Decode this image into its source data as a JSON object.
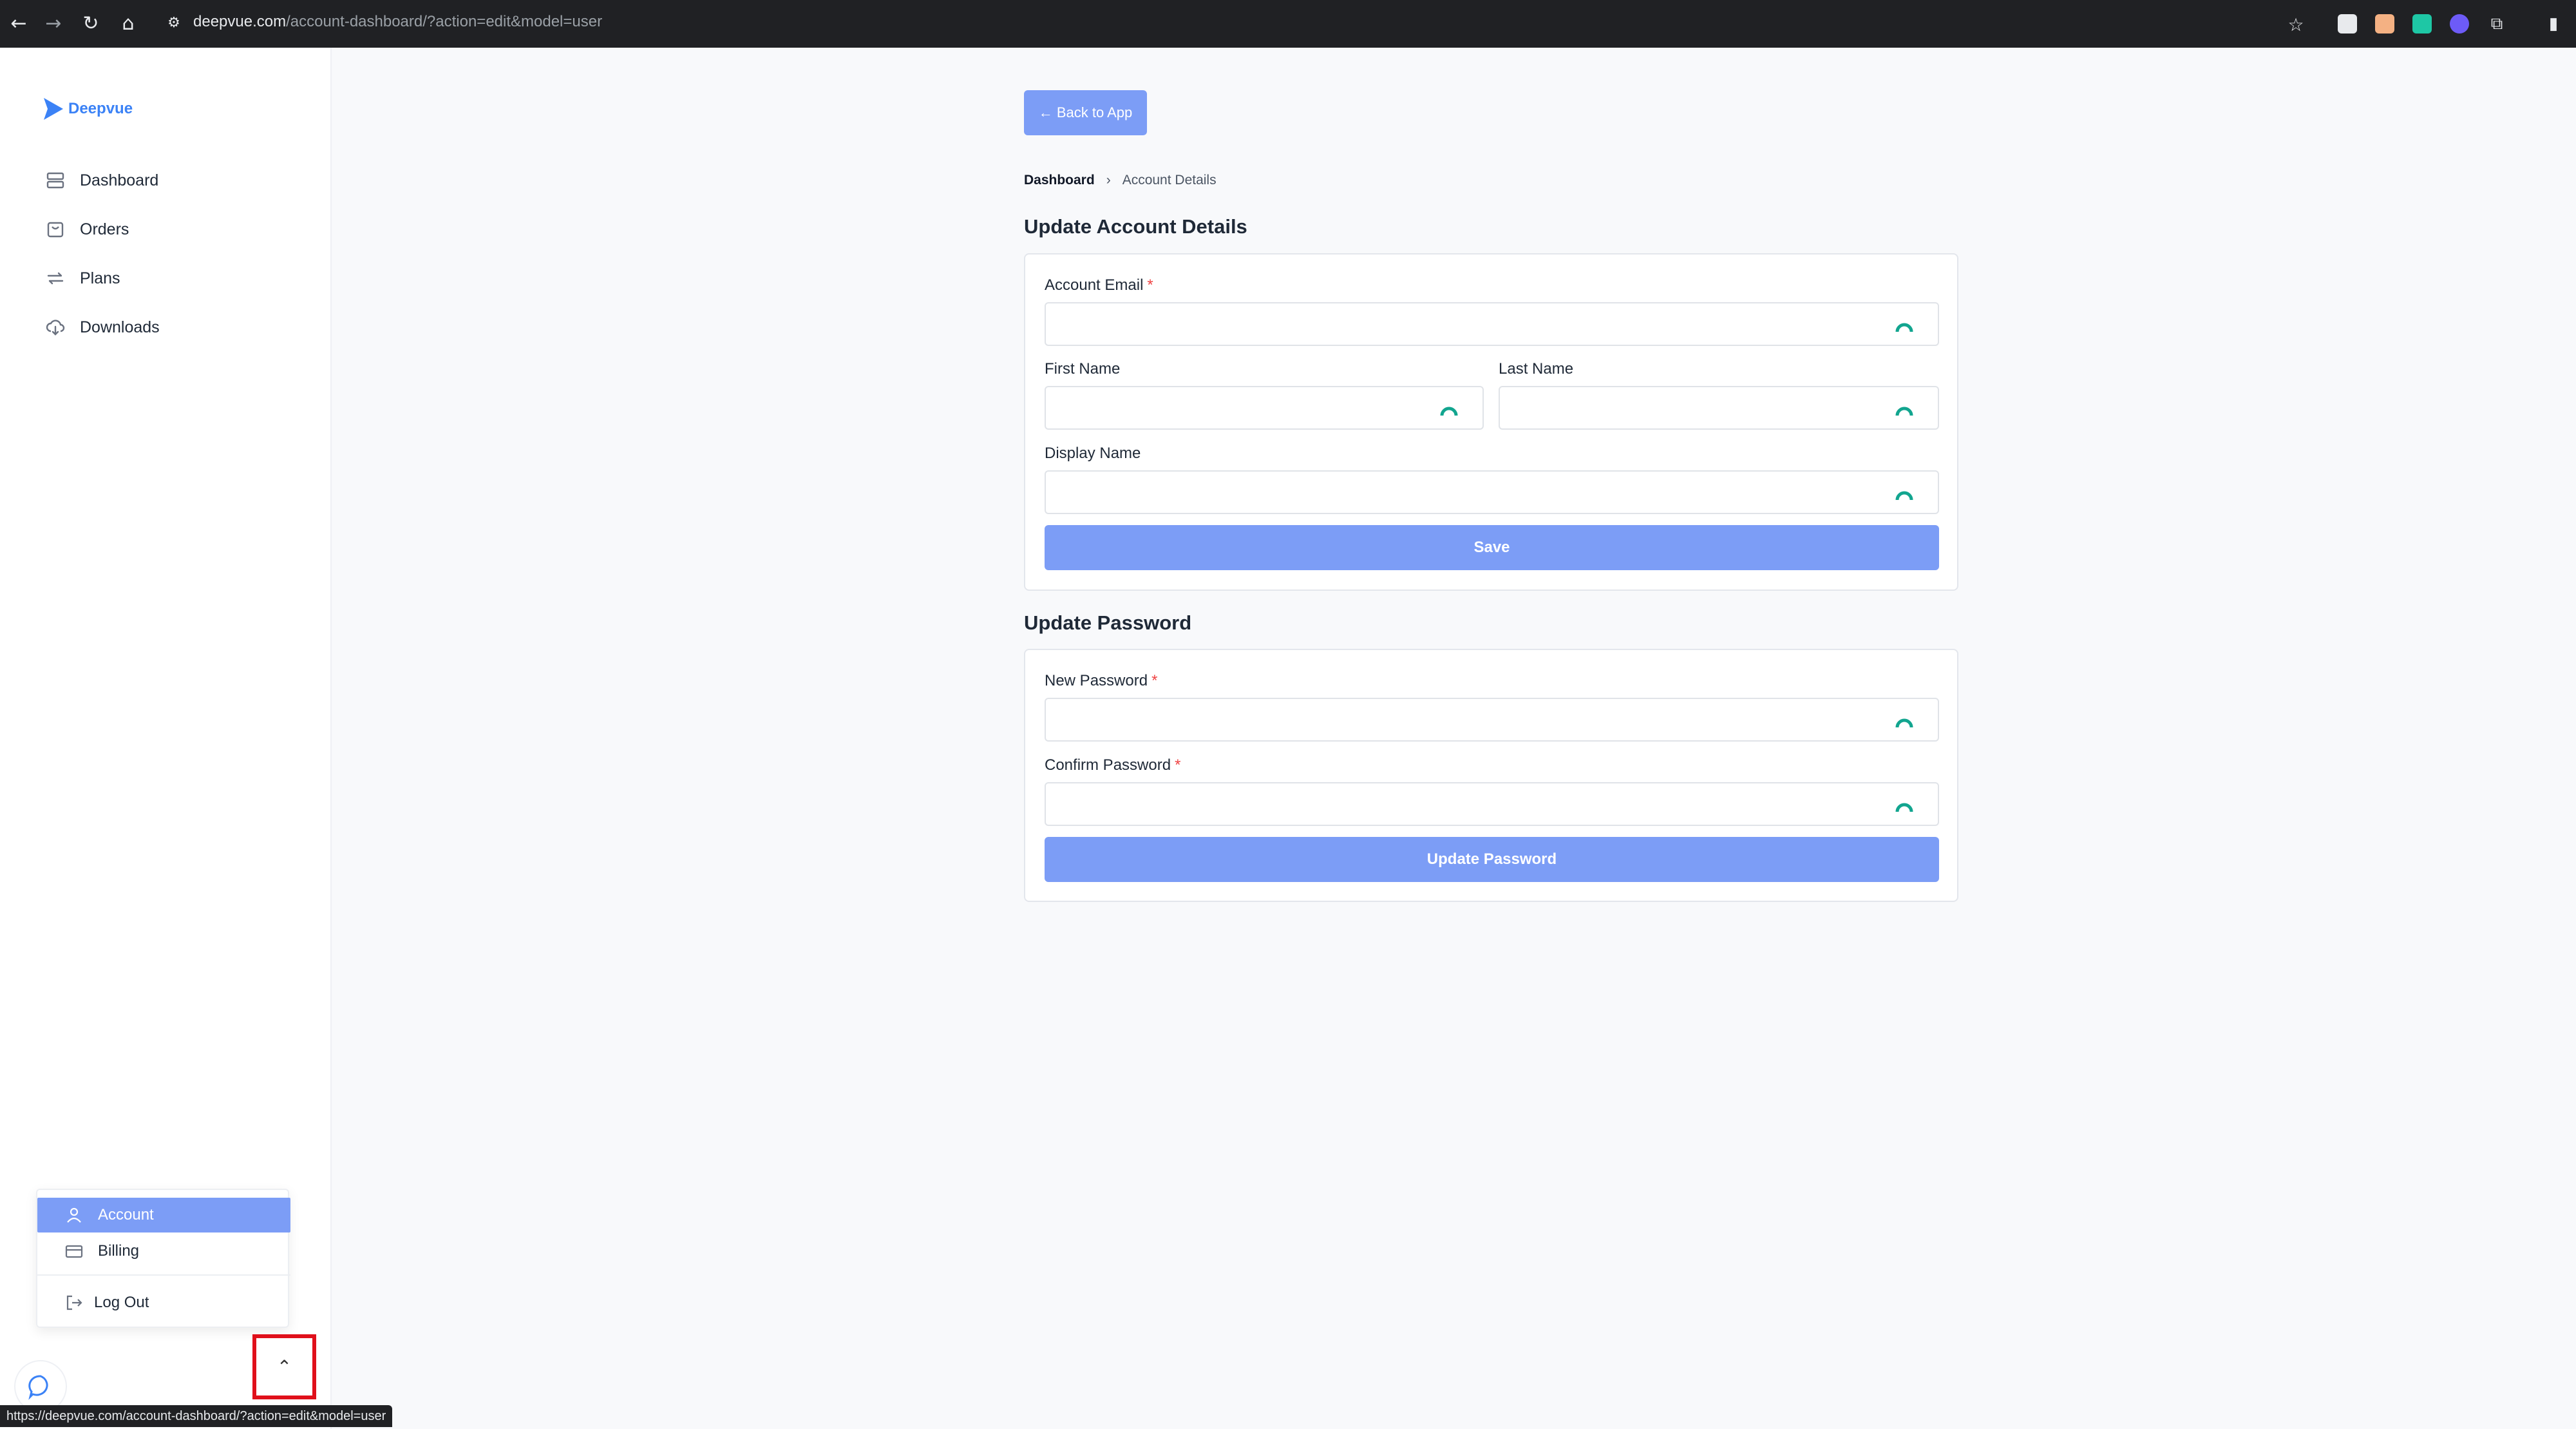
{
  "browser": {
    "url_host": "deepvue.com",
    "url_path": "/account-dashboard/?action=edit&model=user",
    "status_url": "https://deepvue.com/account-dashboard/?action=edit&model=user"
  },
  "brand": {
    "name": "Deepvue",
    "color": "#3b82f6"
  },
  "sidebar": {
    "items": [
      {
        "label": "Dashboard",
        "icon": "dashboard-icon"
      },
      {
        "label": "Orders",
        "icon": "shopping-bag-icon"
      },
      {
        "label": "Plans",
        "icon": "repeat-icon"
      },
      {
        "label": "Downloads",
        "icon": "cloud-download-icon"
      }
    ]
  },
  "user_menu": {
    "account_label": "Account",
    "billing_label": "Billing",
    "logout_label": "Log Out",
    "toggle_glyph": "⌃"
  },
  "main": {
    "back_label": "← Back to App",
    "breadcrumb": {
      "home": "Dashboard",
      "separator": "›",
      "current": "Account Details"
    },
    "account_section": {
      "title": "Update Account Details",
      "email_label": "Account Email",
      "first_name_label": "First Name",
      "last_name_label": "Last Name",
      "display_name_label": "Display Name",
      "save_label": "Save"
    },
    "password_section": {
      "title": "Update Password",
      "new_password_label": "New Password",
      "confirm_password_label": "Confirm Password",
      "update_label": "Update Password"
    },
    "required_marker": "*"
  },
  "colors": {
    "accent": "#7c9df6",
    "required": "#ef4444",
    "highlight": "#e0101b"
  }
}
